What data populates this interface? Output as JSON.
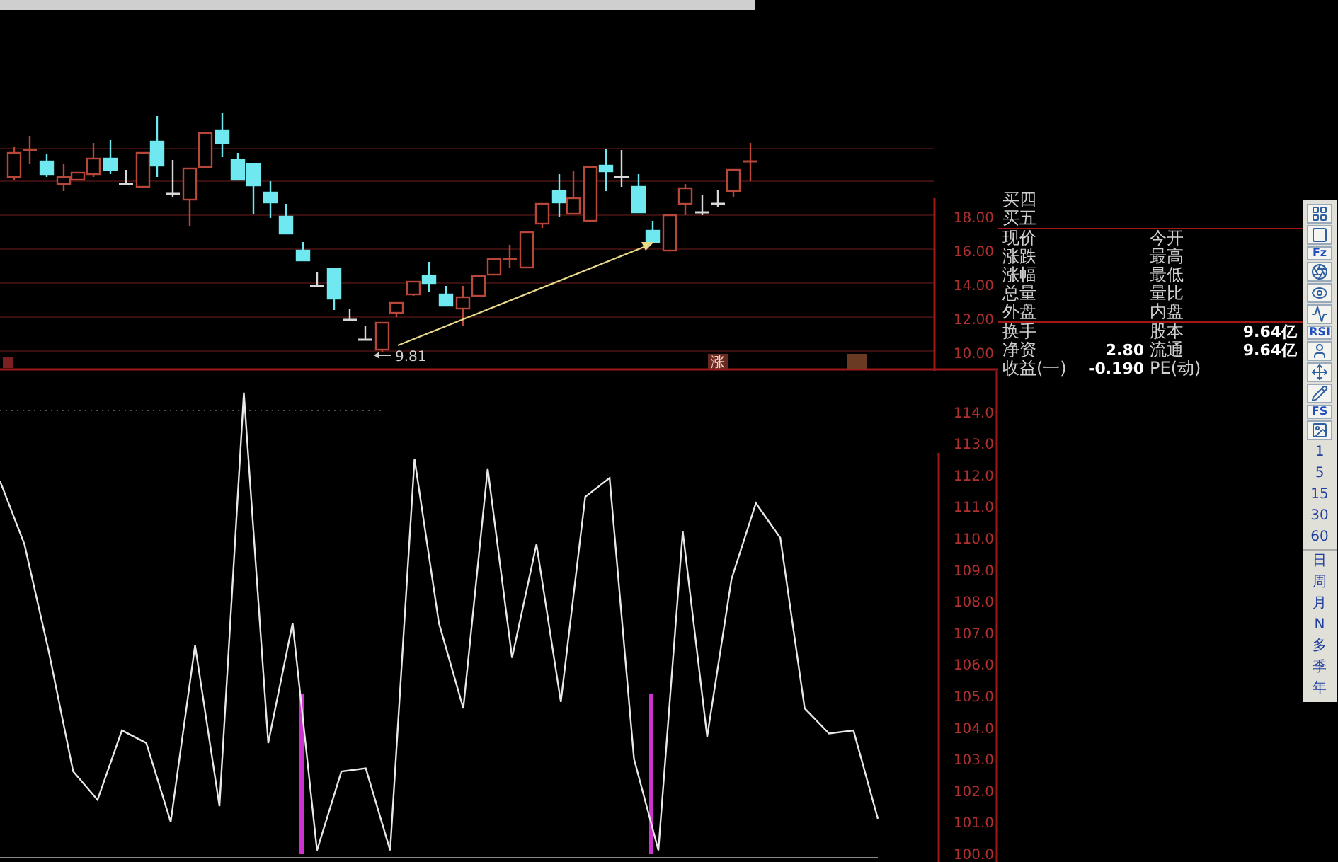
{
  "price_chart": {
    "axis_labels": [
      "18.00",
      "16.00",
      "14.00",
      "12.00",
      "10.00"
    ],
    "low_label": "9.81",
    "markers": [
      {
        "text": "涨"
      }
    ]
  },
  "indicator_chart": {
    "axis_labels": [
      "114.0",
      "113.0",
      "112.0",
      "111.0",
      "110.0",
      "109.0",
      "108.0",
      "107.0",
      "106.0",
      "105.0",
      "104.0",
      "103.0",
      "102.0",
      "101.0",
      "100.0"
    ]
  },
  "quote_panel": {
    "sections": [
      [
        {
          "label": "买四"
        },
        {
          "label": "买五"
        }
      ],
      [
        {
          "label": "现价",
          "label2": "今开"
        },
        {
          "label": "涨跌",
          "label2": "最高"
        },
        {
          "label": "涨幅",
          "label2": "最低"
        },
        {
          "label": "总量",
          "label2": "量比"
        },
        {
          "label": "外盘",
          "label2": "内盘"
        }
      ],
      [
        {
          "label": "换手",
          "label2": "股本",
          "value2": "9.64亿"
        },
        {
          "label": "净资",
          "value": "2.80",
          "label2": "流通",
          "value2": "9.64亿"
        },
        {
          "label": "收益(一)",
          "value": "-0.190",
          "label2": "PE(动)"
        }
      ]
    ]
  },
  "toolbar": {
    "buttons": [
      {
        "kind": "icon"
      },
      {
        "kind": "icon"
      },
      {
        "kind": "label",
        "text": "Fz"
      },
      {
        "kind": "icon"
      },
      {
        "kind": "icon"
      },
      {
        "kind": "icon"
      },
      {
        "kind": "label",
        "text": "RSI"
      },
      {
        "kind": "icon"
      },
      {
        "kind": "icon"
      },
      {
        "kind": "icon"
      },
      {
        "kind": "label",
        "text": "FS"
      },
      {
        "kind": "icon"
      }
    ],
    "periods": [
      "1",
      "5",
      "15",
      "30",
      "60"
    ],
    "cycles": [
      "日",
      "周",
      "月",
      "N",
      "多",
      "季",
      "年"
    ]
  }
}
